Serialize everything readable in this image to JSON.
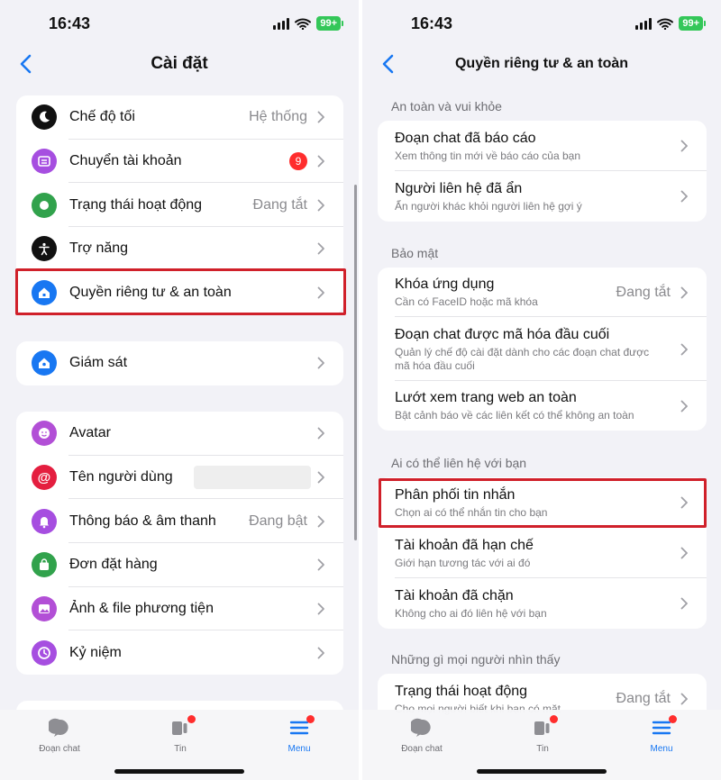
{
  "status": {
    "time": "16:43",
    "battery": "99+"
  },
  "left": {
    "title": "Cài đặt",
    "group1": [
      {
        "label": "Chế độ tối",
        "value": "Hệ thống",
        "icon": "moon-icon",
        "color": "#111111"
      },
      {
        "label": "Chuyển tài khoản",
        "badge": "9",
        "icon": "switch-account-icon",
        "color": "#a64ee0"
      },
      {
        "label": "Trạng thái hoạt động",
        "value": "Đang tắt",
        "icon": "active-status-icon",
        "color": "#31a24c"
      },
      {
        "label": "Trợ năng",
        "value": "",
        "icon": "accessibility-icon",
        "color": "#111111"
      },
      {
        "label": "Quyền riêng tư & an toàn",
        "value": "",
        "icon": "privacy-home-icon",
        "color": "#1877f2"
      }
    ],
    "group2": [
      {
        "label": "Giám sát",
        "icon": "supervision-icon",
        "color": "#1877f2"
      }
    ],
    "group3": [
      {
        "label": "Avatar",
        "value": "",
        "icon": "avatar-icon",
        "color": "#b24fd6"
      },
      {
        "label": "Tên người dùng",
        "value": "",
        "icon": "at-icon",
        "color": "#e41e3f"
      },
      {
        "label": "Thông báo & âm thanh",
        "value": "Đang bật",
        "icon": "bell-icon",
        "color": "#a64ee0"
      },
      {
        "label": "Đơn đặt hàng",
        "value": "",
        "icon": "shopping-bag-icon",
        "color": "#31a24c"
      },
      {
        "label": "Ảnh & file phương tiện",
        "value": "",
        "icon": "photo-icon",
        "color": "#b24fd6"
      },
      {
        "label": "Kỷ niệm",
        "value": "",
        "icon": "memories-icon",
        "color": "#a64ee0"
      }
    ]
  },
  "right": {
    "title": "Quyền riêng tư & an toàn",
    "sections": [
      {
        "header": "An toàn và vui khỏe",
        "rows": [
          {
            "title": "Đoạn chat đã báo cáo",
            "sub": "Xem thông tin mới về báo cáo của bạn",
            "value": ""
          },
          {
            "title": "Người liên hệ đã ẩn",
            "sub": "Ẩn người khác khỏi người liên hệ gợi ý",
            "value": ""
          }
        ]
      },
      {
        "header": "Bảo mật",
        "rows": [
          {
            "title": "Khóa ứng dụng",
            "sub": "Cần có FaceID hoặc mã khóa",
            "value": "Đang tắt"
          },
          {
            "title": "Đoạn chat được mã hóa đầu cuối",
            "sub": "Quản lý chế độ cài đặt dành cho các đoạn chat được mã hóa đầu cuối",
            "value": ""
          },
          {
            "title": "Lướt xem trang web an toàn",
            "sub": "Bật cảnh báo về các liên kết có thể không an toàn",
            "value": ""
          }
        ]
      },
      {
        "header": "Ai có thể liên hệ với bạn",
        "rows": [
          {
            "title": "Phân phối tin nhắn",
            "sub": "Chọn ai có thể nhắn tin cho bạn",
            "value": ""
          },
          {
            "title": "Tài khoản đã hạn chế",
            "sub": "Giới hạn tương tác với ai đó",
            "value": ""
          },
          {
            "title": "Tài khoản đã chặn",
            "sub": "Không cho ai đó liên hệ với bạn",
            "value": ""
          }
        ]
      },
      {
        "header": "Những gì mọi người nhìn thấy",
        "rows": [
          {
            "title": "Trạng thái hoạt động",
            "sub": "Cho mọi người biết khi bạn có mặt",
            "value": "Đang tắt"
          }
        ]
      }
    ]
  },
  "tabs": [
    {
      "label": "Đoạn chat",
      "icon": "chat-bubble-icon",
      "active": false
    },
    {
      "label": "Tin",
      "icon": "stories-icon",
      "active": false
    },
    {
      "label": "Menu",
      "icon": "menu-icon",
      "active": true
    }
  ],
  "colors": {
    "accent": "#1877f2",
    "highlight": "#d0202a",
    "badge": "#ff2d2d"
  }
}
